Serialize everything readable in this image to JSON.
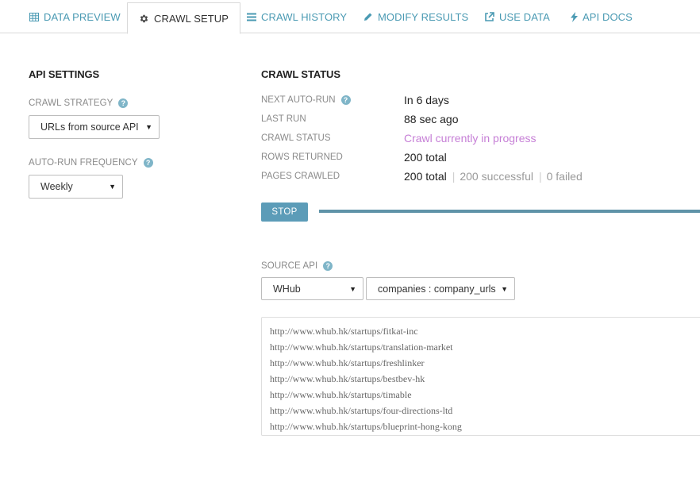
{
  "tabs": [
    {
      "label": "DATA PREVIEW",
      "icon": "table-icon"
    },
    {
      "label": "CRAWL SETUP",
      "icon": "gear-icon",
      "active": true
    },
    {
      "label": "CRAWL HISTORY",
      "icon": "list-icon"
    },
    {
      "label": "MODIFY RESULTS",
      "icon": "pencil-icon"
    },
    {
      "label": "USE DATA",
      "icon": "external-link-icon"
    },
    {
      "label": "API DOCS",
      "icon": "bolt-icon"
    }
  ],
  "api_settings": {
    "title": "API SETTINGS",
    "crawl_strategy_label": "CRAWL STRATEGY",
    "crawl_strategy_value": "URLs from source API",
    "auto_run_label": "AUTO-RUN FREQUENCY",
    "auto_run_value": "Weekly"
  },
  "crawl_status": {
    "title": "CRAWL STATUS",
    "next_auto_run_label": "NEXT AUTO-RUN",
    "next_auto_run_value": "In 6 days",
    "last_run_label": "LAST RUN",
    "last_run_value": "88 sec ago",
    "status_label": "CRAWL STATUS",
    "status_value": "Crawl currently in progress",
    "rows_label": "ROWS RETURNED",
    "rows_value": "200 total",
    "pages_label": "PAGES CRAWLED",
    "pages_total": "200 total",
    "pages_successful": "200 successful",
    "pages_failed": "0 failed",
    "stop_label": "STOP"
  },
  "source_api": {
    "label": "SOURCE API",
    "api_value": "WHub",
    "column_value": "companies : company_urls",
    "urls": [
      "http://www.whub.hk/startups/fitkat-inc",
      "http://www.whub.hk/startups/translation-market",
      "http://www.whub.hk/startups/freshlinker",
      "http://www.whub.hk/startups/bestbev-hk",
      "http://www.whub.hk/startups/timable",
      "http://www.whub.hk/startups/four-directions-ltd",
      "http://www.whub.hk/startups/blueprint-hong-kong"
    ]
  },
  "colors": {
    "accent": "#4a9ab3",
    "status_purple": "#c67fd6",
    "stop_button": "#5c9cb8",
    "progress": "#5f93a8"
  }
}
